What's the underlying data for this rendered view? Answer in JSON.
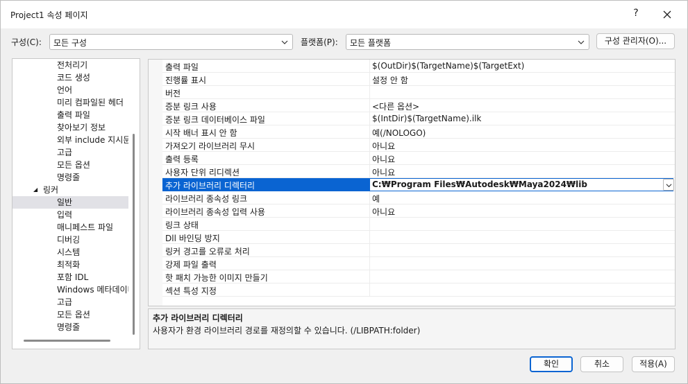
{
  "window": {
    "title": "Project1 속성 페이지",
    "help": "?"
  },
  "toolbar": {
    "config_label": "구성(C):",
    "config_value": "모든 구성",
    "platform_label": "플랫폼(P):",
    "platform_value": "모든 플랫폼",
    "config_manager": "구성 관리자(O)..."
  },
  "tree": {
    "items": [
      {
        "label": "전처리기"
      },
      {
        "label": "코드 생성"
      },
      {
        "label": "언어"
      },
      {
        "label": "미리 컴파일된 헤더"
      },
      {
        "label": "출력 파일"
      },
      {
        "label": "찾아보기 정보"
      },
      {
        "label": "외부 include 지시문"
      },
      {
        "label": "고급"
      },
      {
        "label": "모든 옵션"
      },
      {
        "label": "명령줄"
      },
      {
        "label": "링커",
        "caret": "◢"
      },
      {
        "label": "일반"
      },
      {
        "label": "입력"
      },
      {
        "label": "매니페스트 파일"
      },
      {
        "label": "디버깅"
      },
      {
        "label": "시스템"
      },
      {
        "label": "최적화"
      },
      {
        "label": "포함 IDL"
      },
      {
        "label": "Windows 메타데이터"
      },
      {
        "label": "고급"
      },
      {
        "label": "모든 옵션"
      },
      {
        "label": "명령줄"
      }
    ]
  },
  "grid": {
    "rows": [
      {
        "name": "출력 파일",
        "value": "$(OutDir)$(TargetName)$(TargetExt)"
      },
      {
        "name": "진행률 표시",
        "value": "설정 안 함"
      },
      {
        "name": "버전",
        "value": ""
      },
      {
        "name": "증분 링크 사용",
        "value": "<다른 옵션>"
      },
      {
        "name": "증분 링크 데이터베이스 파일",
        "value": "$(IntDir)$(TargetName).ilk"
      },
      {
        "name": "시작 배너 표시 안 함",
        "value": "예(/NOLOGO)"
      },
      {
        "name": "가져오기 라이브러리 무시",
        "value": "아니요"
      },
      {
        "name": "출력 등록",
        "value": "아니요"
      },
      {
        "name": "사용자 단위 리디렉션",
        "value": "아니요"
      },
      {
        "name": "추가 라이브러리 디렉터리",
        "value": "C:₩Program Files₩Autodesk₩Maya2024₩lib"
      },
      {
        "name": "라이브러리 종속성 링크",
        "value": "예"
      },
      {
        "name": "라이브러리 종속성 입력 사용",
        "value": "아니요"
      },
      {
        "name": "링크 상태",
        "value": ""
      },
      {
        "name": "Dll 바인딩 방지",
        "value": ""
      },
      {
        "name": "링커 경고를 오류로 처리",
        "value": ""
      },
      {
        "name": "강제 파일 출력",
        "value": ""
      },
      {
        "name": "핫 패치 가능한 이미지 만들기",
        "value": ""
      },
      {
        "name": "섹션 특성 지정",
        "value": ""
      }
    ]
  },
  "description": {
    "title": "추가 라이브러리 디렉터리",
    "body": "사용자가 환경 라이브러리 경로를 재정의할 수 있습니다. (/LIBPATH:folder)"
  },
  "buttons": {
    "ok": "확인",
    "cancel": "취소",
    "apply": "적용(A)"
  },
  "colors": {
    "selection": "#0a64d2",
    "tree_selection": "#e1e1e6"
  }
}
